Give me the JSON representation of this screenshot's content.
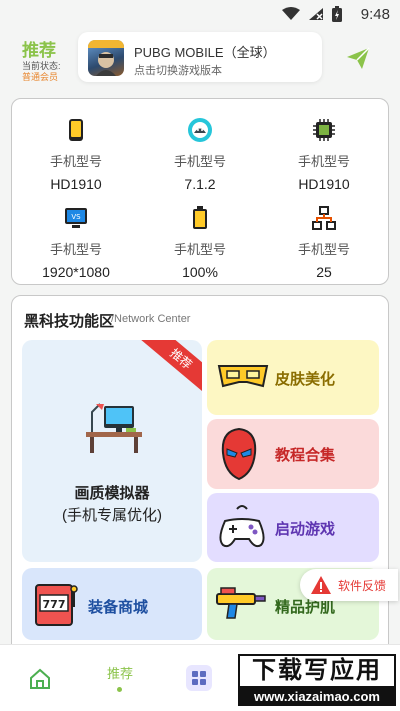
{
  "status_bar": {
    "time": "9:48"
  },
  "header": {
    "title": "推荐",
    "status_label": "当前状态:",
    "member_status": "普通会员",
    "game_name": "PUBG MOBILE（全球）",
    "game_subtitle": "点击切换游戏版本"
  },
  "device_info": [
    {
      "icon": "phone-icon",
      "label": "手机型号",
      "value": "HD1910"
    },
    {
      "icon": "android-icon",
      "label": "手机型号",
      "value": "7.1.2"
    },
    {
      "icon": "chip-icon",
      "label": "手机型号",
      "value": "HD1910"
    },
    {
      "icon": "monitor-icon",
      "label": "手机型号",
      "value": "1920*1080"
    },
    {
      "icon": "battery-icon",
      "label": "手机型号",
      "value": "100%"
    },
    {
      "icon": "network-icon",
      "label": "手机型号",
      "value": "25"
    }
  ],
  "tech_section": {
    "title": "黑科技功能区",
    "subtitle": "/Network Center",
    "big_tile": {
      "line1": "画质模拟器",
      "line2": "(手机专属优化)",
      "badge": "推荐"
    },
    "tiles": [
      {
        "label": "皮肤美化",
        "bg": "#fdf7c3",
        "color": "#8a6d00"
      },
      {
        "label": "教程合集",
        "bg": "#fbdada",
        "color": "#c62828"
      },
      {
        "label": "启动游戏",
        "bg": "#e3ddff",
        "color": "#5e35b1"
      },
      {
        "label": "装备商城",
        "bg": "#d9e6fb",
        "color": "#1e4fa0"
      },
      {
        "label": "精品护肌",
        "bg": "#e4f7d9",
        "color": "#33691e"
      }
    ]
  },
  "feedback": {
    "label": "软件反馈"
  },
  "bottom_nav": {
    "recommend_label": "推荐"
  },
  "watermark": {
    "top": "下载写应用",
    "bottom": "www.xiazaimao.com"
  }
}
